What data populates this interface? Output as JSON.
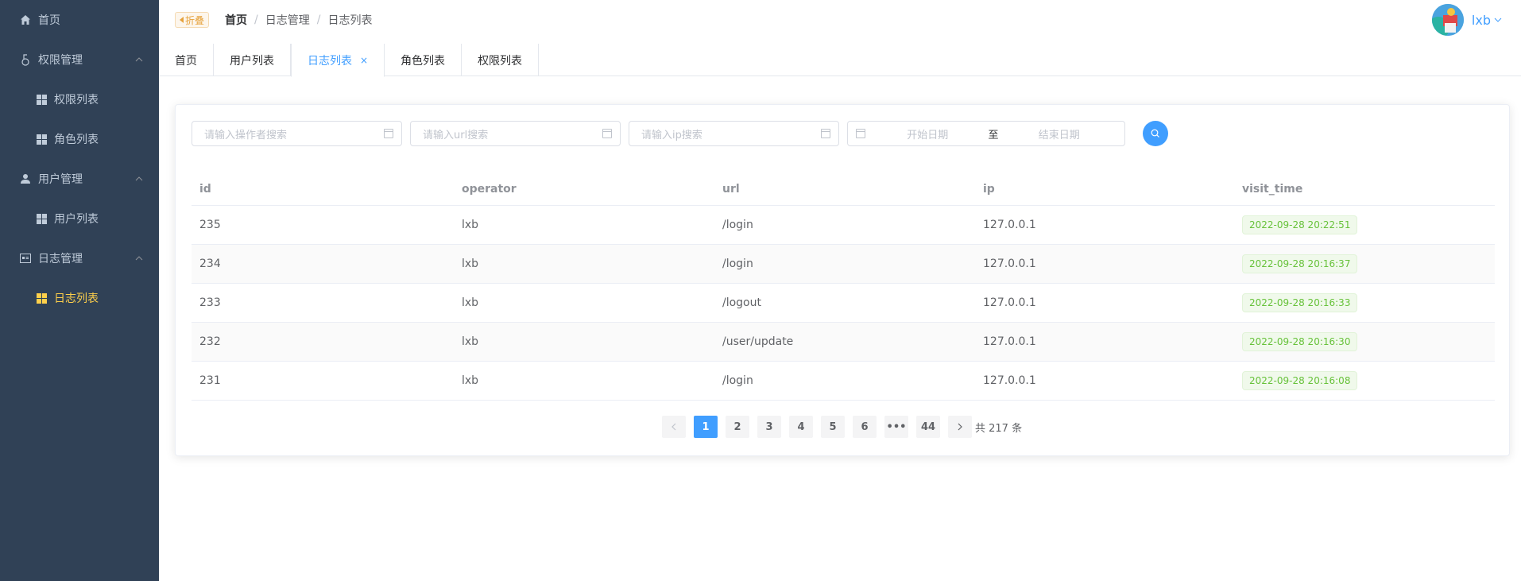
{
  "sidebar": {
    "items": [
      {
        "label": "首页",
        "icon": "home-icon"
      },
      {
        "label": "权限管理",
        "icon": "lock-icon",
        "expanded": true
      },
      {
        "label": "权限列表",
        "icon": "grid-icon"
      },
      {
        "label": "角色列表",
        "icon": "grid-icon"
      },
      {
        "label": "用户管理",
        "icon": "user-icon",
        "expanded": true
      },
      {
        "label": "用户列表",
        "icon": "grid-icon"
      },
      {
        "label": "日志管理",
        "icon": "document-icon",
        "expanded": true
      },
      {
        "label": "日志列表",
        "icon": "grid-icon",
        "active": true
      }
    ],
    "bg_color": "#304156",
    "active_color": "#ffd04b"
  },
  "header": {
    "fold_label": "折叠",
    "breadcrumb": [
      "首页",
      "日志管理",
      "日志列表"
    ],
    "breadcrumb_sep": "/",
    "user_name": "lxb"
  },
  "tabs": [
    {
      "label": "首页"
    },
    {
      "label": "用户列表"
    },
    {
      "label": "日志列表",
      "active": true,
      "close": "×"
    },
    {
      "label": "角色列表"
    },
    {
      "label": "权限列表"
    }
  ],
  "search": {
    "operator_placeholder": "请输入操作者搜索",
    "url_placeholder": "请输入url搜索",
    "ip_placeholder": "请输入ip搜索",
    "start_date_placeholder": "开始日期",
    "range_separator": "至",
    "end_date_placeholder": "结束日期"
  },
  "table": {
    "columns": [
      "id",
      "operator",
      "url",
      "ip",
      "visit_time"
    ],
    "rows": [
      {
        "id": "235",
        "operator": "lxb",
        "url": "/login",
        "ip": "127.0.0.1",
        "visit_time": "2022-09-28 20:22:51"
      },
      {
        "id": "234",
        "operator": "lxb",
        "url": "/login",
        "ip": "127.0.0.1",
        "visit_time": "2022-09-28 20:16:37"
      },
      {
        "id": "233",
        "operator": "lxb",
        "url": "/logout",
        "ip": "127.0.0.1",
        "visit_time": "2022-09-28 20:16:33"
      },
      {
        "id": "232",
        "operator": "lxb",
        "url": "/user/update",
        "ip": "127.0.0.1",
        "visit_time": "2022-09-28 20:16:30"
      },
      {
        "id": "231",
        "operator": "lxb",
        "url": "/login",
        "ip": "127.0.0.1",
        "visit_time": "2022-09-28 20:16:08"
      }
    ]
  },
  "pagination": {
    "pages": [
      "1",
      "2",
      "3",
      "4",
      "5",
      "6",
      "•••",
      "44"
    ],
    "current": "1",
    "total_text": "共 217 条"
  },
  "colors": {
    "primary": "#409eff",
    "success_tag": "#67c23a",
    "warning": "#e6a23c"
  }
}
